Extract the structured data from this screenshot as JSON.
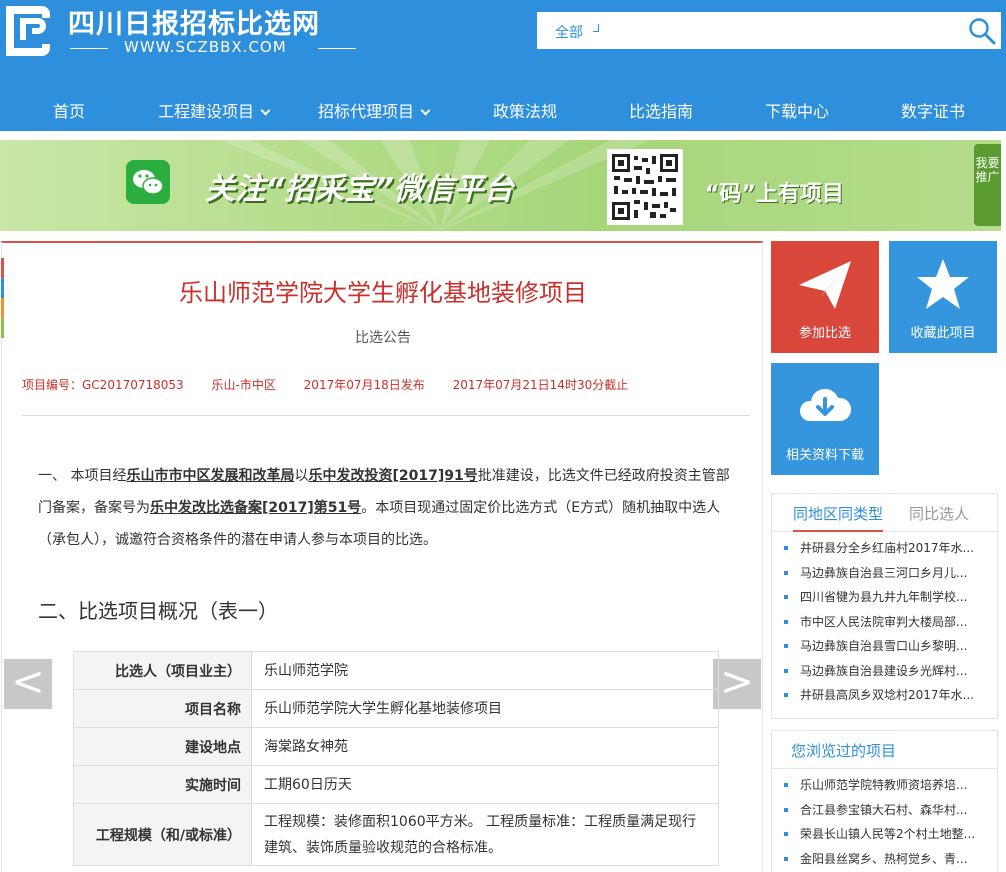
{
  "site": {
    "title": "四川日报招标比选网",
    "url": "WWW.SCZBBX.COM"
  },
  "search": {
    "category": "全部",
    "placeholder": ""
  },
  "nav": [
    {
      "label": "首页"
    },
    {
      "label": "工程建设项目"
    },
    {
      "label": "招标代理项目"
    },
    {
      "label": "政策法规"
    },
    {
      "label": "比选指南"
    },
    {
      "label": "下载中心"
    },
    {
      "label": "数字证书"
    }
  ],
  "banner": {
    "slogan": "关注“招采宝”微信平台",
    "code_text": "“码”上有项目",
    "recommend": "我要推广"
  },
  "article": {
    "title": "乐山师范学院大学生孵化基地装修项目",
    "subtitle": "比选公告",
    "meta": {
      "code": "项目编号：GC20170718053",
      "region": "乐山-市中区",
      "published": "2017年07月18日发布",
      "deadline": "2017年07月21日14时30分截止"
    },
    "para": {
      "t1": "一、 本项目经",
      "b1": "乐山市市中区发展和改革局",
      "t2": "以",
      "b2": "乐中发改投资[2017]91号",
      "t3": "批准建设，比选文件已经政府投资主管部门备案，备案号为",
      "b3": "乐中发改比选备案[2017]第51号",
      "t4": "。本项目现通过固定价比选方式（E方式）随机抽取中选人（承包人），诚邀符合资格条件的潜在申请人参与本项目的比选。"
    },
    "section_title": "二、比选项目概况（表一）",
    "table": [
      {
        "key": "比选人（项目业主）",
        "value": "乐山师范学院"
      },
      {
        "key": "项目名称",
        "value": "乐山师范学院大学生孵化基地装修项目"
      },
      {
        "key": "建设地点",
        "value": "海棠路女神苑"
      },
      {
        "key": "实施时间",
        "value": "工期60日历天"
      },
      {
        "key": "工程规模（和/或标准）",
        "value": "工程规模：装修面积1060平方米。 工程质量标准：工程质量满足现行建筑、装饰质量验收规范的合格标准。"
      }
    ],
    "prev_arrow": "<",
    "next_arrow": ">"
  },
  "sidebar": {
    "tiles": [
      {
        "label": "参加比选",
        "color": "#d9463a",
        "icon": "paper-plane-icon"
      },
      {
        "label": "收藏此项目",
        "color": "#3596dd",
        "icon": "star-icon"
      },
      {
        "label": "相关资料下载",
        "color": "#3596dd",
        "icon": "cloud-download-icon"
      }
    ],
    "related": {
      "tab_active": "同地区同类型",
      "tab_inactive": "同比选人",
      "items": [
        "井研县分全乡红庙村2017年水...",
        "马边彝族自治县三河口乡月儿...",
        "四川省犍为县九井九年制学校...",
        "市中区人民法院审判大楼局部...",
        "马边彝族自治县雪口山乡黎明...",
        "马边彝族自治县建设乡光辉村...",
        "井研县高凤乡双埝村2017年水..."
      ]
    },
    "viewed": {
      "title": "您浏览过的项目",
      "items": [
        "乐山师范学院特教师资培养培...",
        "合江县参宝镇大石村、森华村...",
        "荣县长山镇人民等2个村土地整...",
        "金阳县丝窝乡、热柯觉乡、青..."
      ]
    }
  },
  "colors": {
    "brand_blue": "#2e8fdd",
    "title_red": "#c9302c",
    "banner_green": "#a6d57a"
  }
}
